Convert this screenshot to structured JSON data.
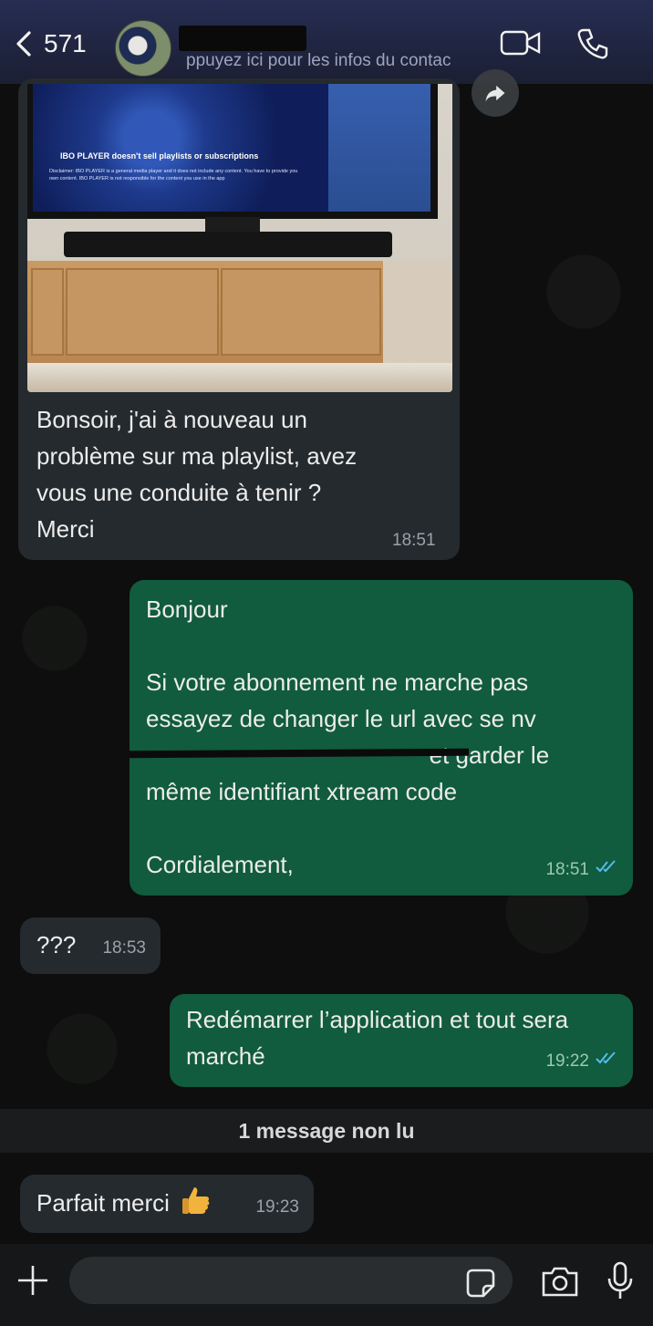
{
  "header": {
    "back_count": "571",
    "subtitle": "ppuyez ici pour les infos du contac"
  },
  "messages": [
    {
      "text": "Bonsoir, j'ai à nouveau un\nproblème sur ma playlist, avez\nvous une conduite à tenir ?\nMerci",
      "time": "18:51"
    },
    {
      "text": "Bonjour\n\nSi votre abonnement ne marche pas\nessayez de changer le url avec se nv\n                                           et garder le\nmême identifiant xtream code\n\nCordialement,",
      "time": "18:51"
    },
    {
      "text": "???",
      "time": "18:53"
    },
    {
      "text": "Redémarrer l’application et tout sera\nmarché",
      "time": "19:22"
    },
    {
      "text": "Parfait merci",
      "time": "19:23"
    }
  ],
  "photo": {
    "screen_title": "IBO PLAYER doesn't sell playlists or subscriptions",
    "screen_disclaimer": "Disclaimer: IBO PLAYER is a general media player and it does not include any content. You have to provide you own content. IBO PLAYER is not responsible for the content you use in the app"
  },
  "unread_label": "1 message non lu",
  "composer": {
    "placeholder": ""
  },
  "colors": {
    "header_bg": "#1e2340",
    "incoming_bubble": "#252a2e",
    "outgoing_bubble": "#115b3e",
    "read_ticks": "#53bdeb"
  },
  "icons": [
    "chevron-left-icon",
    "video-call-icon",
    "phone-icon",
    "forward-icon",
    "read-ticks-icon",
    "thumbs-up-emoji",
    "plus-icon",
    "sticker-icon",
    "camera-icon",
    "mic-icon"
  ]
}
